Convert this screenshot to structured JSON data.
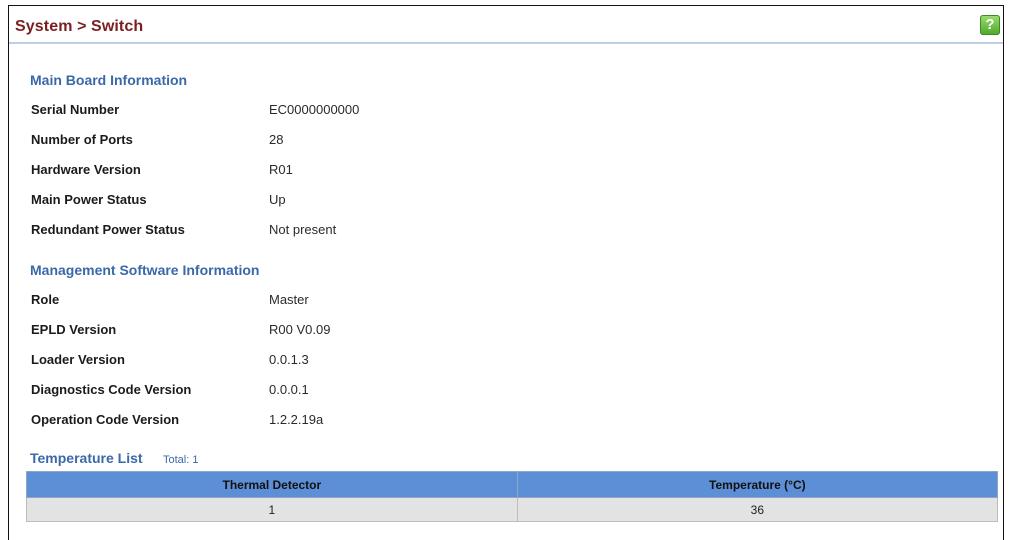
{
  "header": {
    "breadcrumb": "System > Switch",
    "help_label": "?"
  },
  "main_board": {
    "title": "Main Board Information",
    "rows": [
      {
        "label": "Serial Number",
        "value": "EC0000000000"
      },
      {
        "label": "Number of Ports",
        "value": "28"
      },
      {
        "label": "Hardware Version",
        "value": "R01"
      },
      {
        "label": "Main Power Status",
        "value": "Up"
      },
      {
        "label": "Redundant Power Status",
        "value": "Not present"
      }
    ]
  },
  "software": {
    "title": "Management Software Information",
    "rows": [
      {
        "label": "Role",
        "value": "Master"
      },
      {
        "label": "EPLD Version",
        "value": "R00 V0.09"
      },
      {
        "label": "Loader Version",
        "value": "0.0.1.3"
      },
      {
        "label": "Diagnostics Code Version",
        "value": "0.0.0.1"
      },
      {
        "label": "Operation Code Version",
        "value": "1.2.2.19a"
      }
    ]
  },
  "temperature": {
    "title": "Temperature List",
    "total": "Total: 1",
    "columns": [
      "Thermal Detector",
      "Temperature (°C)"
    ],
    "rows": [
      [
        "1",
        "36"
      ]
    ]
  },
  "colors": {
    "breadcrumb": "#7a1f1f",
    "section_title": "#3b68a8",
    "table_header": "#5d8fd6",
    "table_row": "#e3e3e3",
    "help_button": "#4ea62d"
  },
  "icons": {
    "help": "help-icon"
  }
}
